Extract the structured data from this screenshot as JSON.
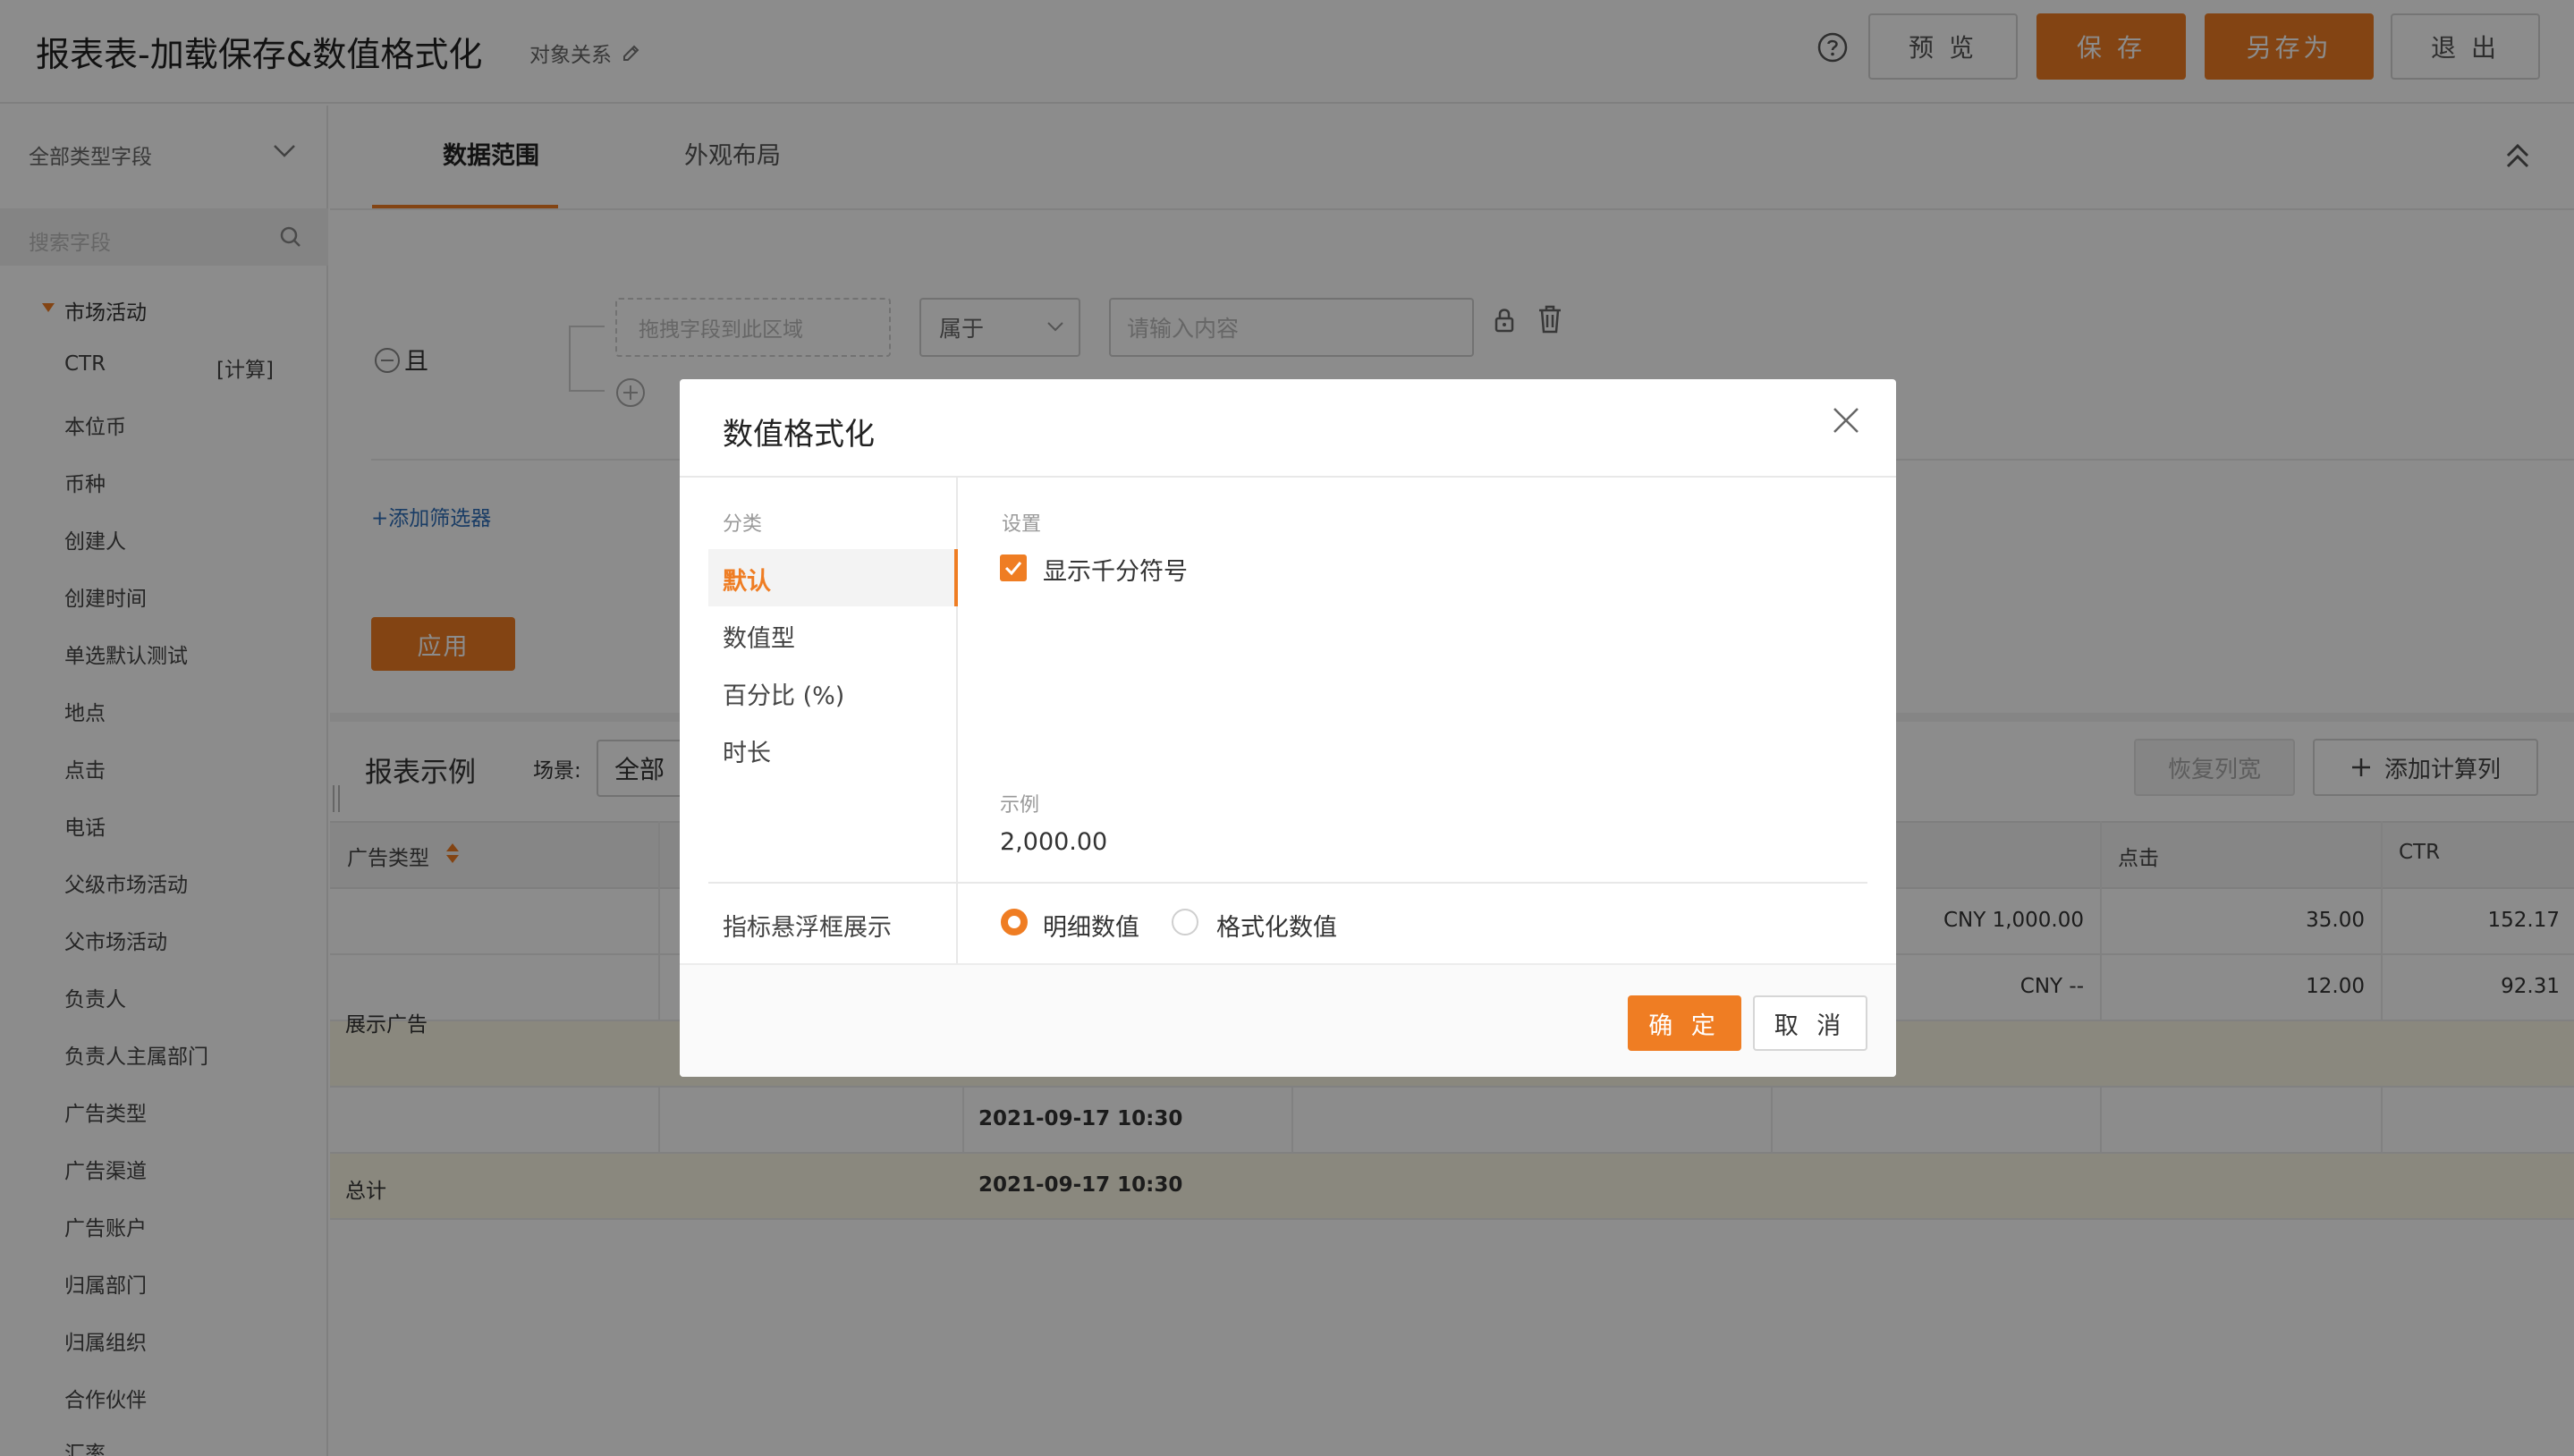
{
  "header": {
    "title": "报表表-加载保存&数值格式化",
    "object_relation": "对象关系",
    "help_icon": "question-circle-icon",
    "buttons": {
      "preview": "预 览",
      "save": "保 存",
      "save_as": "另存为",
      "exit": "退 出"
    },
    "accent_color": "#ef7d23"
  },
  "sidebar": {
    "type_select": "全部类型字段",
    "search_placeholder": "搜索字段",
    "group": "市场活动",
    "fields": [
      {
        "label": "CTR",
        "tag": "[计算]"
      },
      {
        "label": "本位币"
      },
      {
        "label": "币种"
      },
      {
        "label": "创建人"
      },
      {
        "label": "创建时间"
      },
      {
        "label": "单选默认测试"
      },
      {
        "label": "地点"
      },
      {
        "label": "点击"
      },
      {
        "label": "电话"
      },
      {
        "label": "父级市场活动"
      },
      {
        "label": "父市场活动"
      },
      {
        "label": "负责人"
      },
      {
        "label": "负责人主属部门"
      },
      {
        "label": "广告类型"
      },
      {
        "label": "广告渠道"
      },
      {
        "label": "广告账户"
      },
      {
        "label": "归属部门"
      },
      {
        "label": "归属组织"
      },
      {
        "label": "合作伙伴"
      },
      {
        "label": "汇率"
      }
    ]
  },
  "tabs": {
    "data_range": "数据范围",
    "appearance": "外观布局"
  },
  "filter": {
    "and_label": "且",
    "drop_placeholder": "拖拽字段到此区域",
    "operator": "属于",
    "value_placeholder": "请输入内容",
    "add_filter": "+添加筛选器",
    "apply": "应用"
  },
  "report": {
    "title": "报表示例",
    "scene_label": "场景:",
    "scene_value": "全部",
    "restore_columns": "恢复列宽",
    "add_calc_column": "添加计算列",
    "columns": {
      "ad_type": "广告类型",
      "clicks": "点击",
      "ctr": "CTR"
    },
    "rows": [
      {
        "amount": "CNY 1,000.00",
        "clicks": "35.00",
        "ctr": "152.17"
      },
      {
        "amount": "CNY --",
        "clicks": "12.00",
        "ctr": "92.31"
      }
    ],
    "group_label": "展示广告",
    "subtotal_time": "2021-09-17 10:30",
    "total_label": "总计",
    "total_time": "2021-09-17 10:30"
  },
  "modal": {
    "title": "数值格式化",
    "category_label": "分类",
    "categories": [
      "默认",
      "数值型",
      "百分比 (%)",
      "时长"
    ],
    "settings_label": "设置",
    "thousand_separator": "显示千分符号",
    "thousand_separator_checked": true,
    "example_label": "示例",
    "example_value": "2,000.00",
    "hover_label": "指标悬浮框展示",
    "hover_options": [
      "明细数值",
      "格式化数值"
    ],
    "hover_selected": "明细数值",
    "ok": "确 定",
    "cancel": "取 消"
  }
}
